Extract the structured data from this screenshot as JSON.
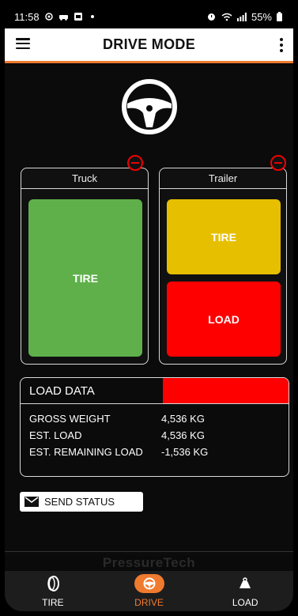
{
  "status_bar": {
    "time": "11:58",
    "battery": "55%"
  },
  "app_bar": {
    "title": "DRIVE MODE"
  },
  "truck": {
    "title": "Truck",
    "tile_label": "TIRE",
    "tile_color": "#5fb04a"
  },
  "trailer": {
    "title": "Trailer",
    "tiles": [
      {
        "label": "TIRE",
        "color": "#e6bf00"
      },
      {
        "label": "LOAD",
        "color": "#ff0000"
      }
    ]
  },
  "load_data": {
    "title": "LOAD DATA",
    "header_color": "#ff0000",
    "rows": [
      {
        "label": "GROSS WEIGHT",
        "value": "4,536 KG"
      },
      {
        "label": "EST. LOAD",
        "value": "4,536 KG"
      },
      {
        "label": "EST. REMAINING LOAD",
        "value": "-1,536 KG"
      }
    ]
  },
  "send_status": {
    "label": "SEND STATUS"
  },
  "brand": {
    "text": "PressureTech"
  },
  "nav": {
    "items": [
      {
        "label": "TIRE",
        "icon": "tire-icon",
        "active": false
      },
      {
        "label": "DRIVE",
        "icon": "steering-wheel-icon",
        "active": true
      },
      {
        "label": "LOAD",
        "icon": "load-weight-icon",
        "active": false
      }
    ]
  },
  "colors": {
    "accent": "#f07a2e",
    "alert": "#ff0000",
    "ok": "#5fb04a",
    "warning": "#e6bf00"
  }
}
